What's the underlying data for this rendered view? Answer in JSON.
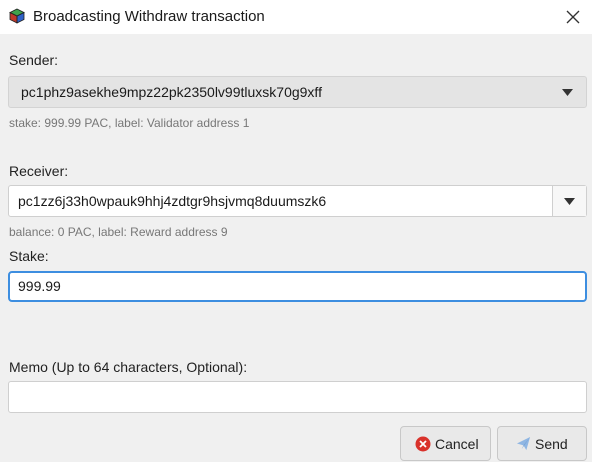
{
  "window": {
    "title": "Broadcasting Withdraw transaction"
  },
  "sender": {
    "label": "Sender:",
    "value": "pc1phz9asekhe9mpz22pk2350lv99tluxsk70g9xff",
    "hint": "stake: 999.99 PAC, label: Validator address 1"
  },
  "receiver": {
    "label": "Receiver:",
    "value": "pc1zz6j33h0wpauk9hhj4zdtgr9hsjvmq8duumszk6",
    "hint": "balance: 0 PAC, label: Reward address 9"
  },
  "stake": {
    "label": "Stake:",
    "value": "999.99"
  },
  "memo": {
    "label": "Memo (Up to 64 characters, Optional):",
    "value": ""
  },
  "buttons": {
    "cancel_label": "Cancel",
    "send_label": "Send"
  },
  "colors": {
    "focus_border": "#3d8ee0",
    "cancel_icon": "#d9322b",
    "send_icon": "#8fb6e3"
  },
  "icons": {
    "app": "app-cube-icon",
    "close": "close-icon",
    "dropdown": "chevron-down-icon",
    "cancel": "cancel-circle-x-icon",
    "send": "paper-plane-icon"
  }
}
